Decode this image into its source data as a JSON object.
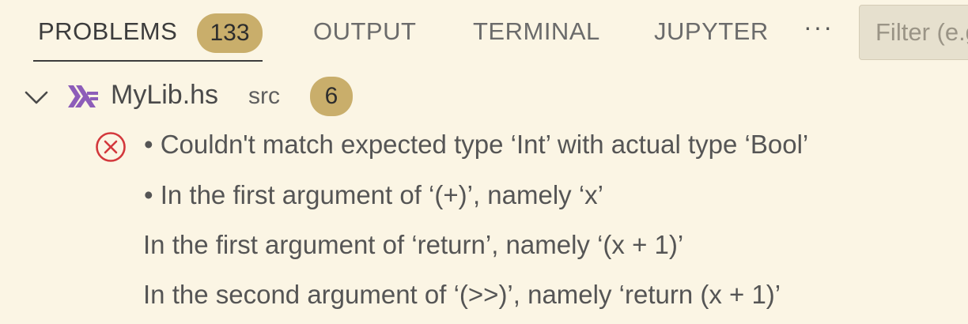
{
  "tabs": [
    {
      "label": "PROBLEMS",
      "badge": "133",
      "active": true
    },
    {
      "label": "OUTPUT"
    },
    {
      "label": "TERMINAL"
    },
    {
      "label": "JUPYTER"
    }
  ],
  "more_label": "···",
  "filter": {
    "placeholder": "Filter (e.g. text, **/*.ts, !**/node_modules/**)"
  },
  "file": {
    "name": "MyLib.hs",
    "folder": "src",
    "count": "6",
    "icon": "haskell-icon"
  },
  "problem": {
    "severity": "error",
    "icon": "error-icon",
    "lines": [
      "• Couldn't match expected type ‘Int’ with actual type ‘Bool’",
      "• In the first argument of ‘(+)’, namely ‘x’",
      "In the first argument of ‘return’, namely ‘(x + 1)’",
      "In the second argument of ‘(>>)’, namely ‘return (x + 1)’"
    ]
  },
  "colors": {
    "background": "#fbf5e4",
    "badge": "#c9ae6b",
    "error": "#d3383c",
    "haskell": "#8d5db9"
  }
}
